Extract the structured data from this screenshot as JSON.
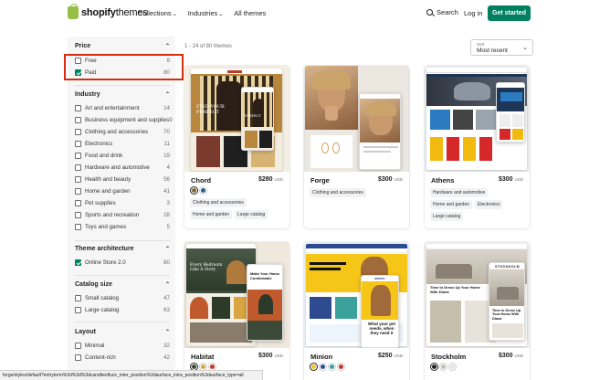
{
  "header": {
    "logo_brand": "shopify",
    "logo_suffix": "themes",
    "nav": [
      {
        "label": "Collections",
        "has_dropdown": true
      },
      {
        "label": "Industries",
        "has_dropdown": true
      },
      {
        "label": "All themes",
        "has_dropdown": false
      }
    ],
    "search_label": "Search",
    "login_label": "Log in",
    "cta_label": "Get started",
    "colors": {
      "cta": "#008060"
    }
  },
  "filters": {
    "price": {
      "title": "Price",
      "options": [
        {
          "label": "Free",
          "count": "9",
          "checked": false
        },
        {
          "label": "Paid",
          "count": "80",
          "checked": true
        }
      ]
    },
    "industry": {
      "title": "Industry",
      "options": [
        {
          "label": "Art and entertainment",
          "count": "14"
        },
        {
          "label": "Business equipment and supplies",
          "count": "9"
        },
        {
          "label": "Clothing and accessories",
          "count": "70"
        },
        {
          "label": "Electronics",
          "count": "11"
        },
        {
          "label": "Food and drink",
          "count": "19"
        },
        {
          "label": "Hardware and automotive",
          "count": "4"
        },
        {
          "label": "Health and beauty",
          "count": "56"
        },
        {
          "label": "Home and garden",
          "count": "41"
        },
        {
          "label": "Pet supplies",
          "count": "3"
        },
        {
          "label": "Sports and recreation",
          "count": "28"
        },
        {
          "label": "Toys and games",
          "count": "5"
        }
      ]
    },
    "architecture": {
      "title": "Theme architecture",
      "options": [
        {
          "label": "Online Store 2.0",
          "count": "80",
          "checked": true
        }
      ]
    },
    "catalog": {
      "title": "Catalog size",
      "options": [
        {
          "label": "Small catalog",
          "count": "47"
        },
        {
          "label": "Large catalog",
          "count": "63"
        }
      ]
    },
    "layout": {
      "title": "Layout",
      "options": [
        {
          "label": "Minimal",
          "count": "32"
        },
        {
          "label": "Content-rich",
          "count": "42"
        }
      ]
    },
    "highlight_color": "#d72c0d"
  },
  "results": {
    "count_text": "1 - 24 of 80 themes",
    "sort_caption": "Sort",
    "sort_value": "Most recent"
  },
  "themes": [
    {
      "name": "Chord",
      "price": "$280",
      "currency": "USD",
      "swatches": [
        "#7a6a2f",
        "#2c5a8a"
      ],
      "tags": [
        "Clothing and accessories",
        "Home and garden",
        "Large catalog"
      ],
      "mock": {
        "hero_headline": "FIND YOUR PERFECT",
        "hero_sub": "PERFECT"
      }
    },
    {
      "name": "Forge",
      "price": "$300",
      "currency": "USD",
      "swatches": [],
      "tags": [
        "Clothing and accessories"
      ]
    },
    {
      "name": "Athens",
      "price": "$300",
      "currency": "USD",
      "swatches": [
        "#1d3557",
        "#2a7bbf",
        "#d62828"
      ],
      "tags": [
        "Hardware and automotive",
        "Home and garden",
        "Electronics",
        "Large catalog"
      ]
    },
    {
      "name": "Habitat",
      "price": "$300",
      "currency": "USD",
      "swatches": [
        "#3c4a3a",
        "#d9a441",
        "#c0392b"
      ],
      "tags": [],
      "mock": {
        "hero_headline": "Every Bedroom Like A Story",
        "phone_headline": "Make Your Home Comfortable"
      }
    },
    {
      "name": "Minion",
      "price": "$250",
      "currency": "USD",
      "swatches": [
        "#f5c518",
        "#2e4b8f",
        "#3aa19b",
        "#c0392b"
      ],
      "tags": [],
      "mock": {
        "phone_headline": "What your pet needs, when they need it",
        "logo": "minion"
      }
    },
    {
      "name": "Stockholm",
      "price": "$300",
      "currency": "USD",
      "swatches": [
        "#222222",
        "#c7bfae",
        "#e8e3da"
      ],
      "tags": [],
      "mock": {
        "site_headline": "Time to Dress Up Your Home With Diana",
        "phone_headline": "Time to Dress Up Your Home With Diana",
        "logo": "STOCKHOLM"
      }
    }
  ],
  "statusbar": {
    "url_text": "forge/styles/default?entrytorm%3d%3d%3dcanditexfluce_inter_position%3daurface_intra_position%3daurface_type=all"
  }
}
